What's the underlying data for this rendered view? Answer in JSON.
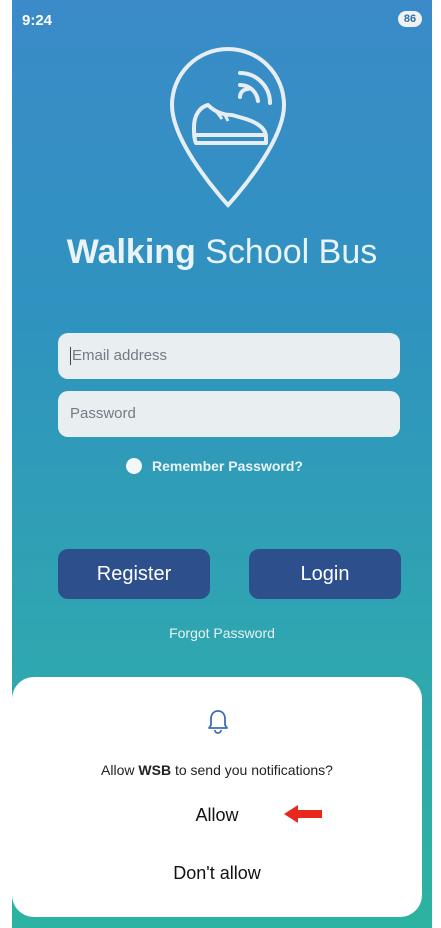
{
  "status_bar": {
    "time": "9:24",
    "battery": "86"
  },
  "app": {
    "title_bold": "Walking",
    "title_rest": " School Bus",
    "logo_icon": "map-pin-shoe-icon"
  },
  "form": {
    "email_placeholder": "Email address",
    "password_placeholder": "Password",
    "remember_label": "Remember Password?",
    "register_label": "Register",
    "login_label": "Login",
    "forgot_label": "Forgot Password"
  },
  "dialog": {
    "icon": "bell-icon",
    "prompt_prefix": "Allow ",
    "prompt_app": "WSB",
    "prompt_suffix": " to send you notifications?",
    "allow_label": "Allow",
    "deny_label": "Don't allow",
    "annotation_icon": "red-arrow-icon"
  },
  "colors": {
    "gradient_top": "#3a8bc8",
    "gradient_bottom": "#2db3a1",
    "button": "#2d4f8c",
    "annotation_arrow": "#e8271f"
  }
}
